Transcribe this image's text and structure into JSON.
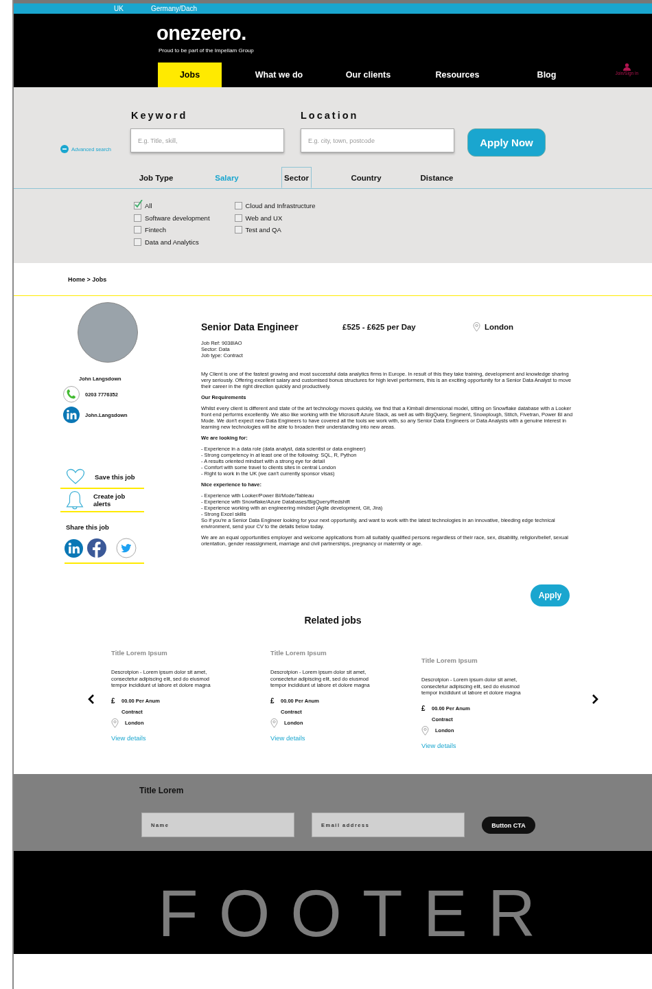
{
  "top_bar": {
    "regions": [
      "UK",
      "Germany/Dach"
    ]
  },
  "header": {
    "logo": "onezeero.",
    "tagline": "Proud to be part of the Impellam Group",
    "account": "Join/Sign in"
  },
  "nav": [
    {
      "label": "Jobs",
      "selected": true
    },
    {
      "label": "What we do",
      "selected": false
    },
    {
      "label": "Our clients",
      "selected": false
    },
    {
      "label": "Resources",
      "selected": false
    },
    {
      "label": "Blog",
      "selected": false
    }
  ],
  "search": {
    "advanced": "Advanced search",
    "keyword_label": "Keyword",
    "keyword_placeholder": "E.g. Title, skill,",
    "location_label": "Location",
    "location_placeholder": "E.g. city, town, postcode",
    "button": "Apply Now"
  },
  "filter_tabs": [
    {
      "label": "Job Type",
      "selected": false,
      "highlighted": false
    },
    {
      "label": "Salary",
      "selected": false,
      "highlighted": true
    },
    {
      "label": "Sector",
      "selected": true,
      "highlighted": false
    },
    {
      "label": "Country",
      "selected": false,
      "highlighted": false
    },
    {
      "label": "Distance",
      "selected": false,
      "highlighted": false
    }
  ],
  "sector_columns": [
    [
      {
        "label": "All",
        "checked": true
      },
      {
        "label": "Software development",
        "checked": false
      },
      {
        "label": "Fintech",
        "checked": false
      },
      {
        "label": "Data and Analytics",
        "checked": false
      }
    ],
    [
      {
        "label": "Cloud and Infrastructure",
        "checked": false
      },
      {
        "label": "Web and UX",
        "checked": false
      },
      {
        "label": "Test and QA",
        "checked": false
      }
    ]
  ],
  "breadcrumb": "Home > Jobs",
  "consultant": {
    "name": "John Langsdown",
    "phone": "0203 7776352",
    "linkedin": "John.Langsdown"
  },
  "actions": [
    "Save this job",
    "Create job alerts"
  ],
  "share": {
    "title": "Share this job"
  },
  "job": {
    "title": "Senior Data Engineer",
    "rate": "£525 - £625 per Day",
    "location": "London",
    "meta": [
      "Job Ref: 9038IAO",
      "Sector: Data",
      "Job type: Contract"
    ],
    "body": [
      {
        "kind": "text",
        "lines": [
          "My Client is one of the fastest growing and most successful data analytics firms in Europe. In result of this they take training, development and knowledge sharing very seriously. Offering excellent salary and customised bonus structures for high level performers, this is an exciting opportunity for a Senior Data Analyst to move their career in the right direction quickly and productively."
        ]
      },
      {
        "kind": "heading",
        "lines": [
          "Our Requirements"
        ]
      },
      {
        "kind": "text",
        "lines": [
          "Whilst every client is different and state of the art technology moves quickly, we find that a Kimball dimensional model, sitting on Snowflake database with a Looker front end performs excellently. We also like working with the Microsoft Azure Stack, as well as with BigQuery, Segment, Snowplough, Stitch, Fivetran, Power BI and Mode. We don't expect new Data Engineers to have covered all the tools we work with, so any Senior Data Engineers or Data Analysts with a genuine interest in learning new technologies will be able to broaden their understanding into new areas."
        ]
      },
      {
        "kind": "heading",
        "lines": [
          "We are looking for:"
        ]
      },
      {
        "kind": "list",
        "lines": [
          "- Experience in a data role (data analyst, data scientist or data engineer)",
          "- Strong competency in at least one of the following: SQL, R, Python",
          "- A results oriented mindset with a strong eye for detail",
          "- Comfort with some travel to clients sites in central London",
          "- Right to work in the UK (we can't currently sponsor visas)"
        ]
      },
      {
        "kind": "heading",
        "lines": [
          "Nice experience to have:"
        ]
      },
      {
        "kind": "tight",
        "lines": [
          "- Experience with Looker/Power BI/Mode/Tableau",
          "- Experience with Snowflake/Azure Databases/BigQuery/Redshift",
          "- Experience working with an engineering mindset (Agile development, Git, Jira)",
          "- Strong Excel skills",
          "So if you're a Senior Data Engineer looking for your next opportunity, and want to work with the latest technologies in an innovative, bleeding edge technical environment, send your CV to the details below today."
        ]
      },
      {
        "kind": "text",
        "lines": [
          "We are an equal opportunities employer and welcome applications from all suitably qualified persons regardless of their race, sex, disability, religion/belief, sexual orientation, gender reassignment, marriage and civil partnerships, pregnancy or maternity or age."
        ]
      }
    ],
    "apply": "Apply"
  },
  "related": {
    "title": "Related jobs",
    "cards": [
      {
        "title": "Title Lorem Ipsum",
        "description": "Descrotpion - Lorem ipsum dolor sit amet, consectetur adipiscing elit, sed do eiusmod tempor incididunt ut labore et dolore magna",
        "currency": "£",
        "salary": "00.00 Per Anum",
        "type": "Contract",
        "location": "London",
        "link": "View details"
      },
      {
        "title": "Title Lorem Ipsum",
        "description": "Descrotpion - Lorem ipsum dolor sit amet, consectetur adipiscing elit, sed do eiusmod tempor incididunt ut labore et dolore magna",
        "currency": "£",
        "salary": "00.00 Per Anum",
        "type": "Contract",
        "location": "London",
        "link": "View details"
      },
      {
        "title": "Title Lorem Ipsum",
        "description": "Descrotpion - Lorem ipsum dolor sit amet, consectetur adipiscing elit, sed do eiusmod tempor incididunt ut labore et dolore magna",
        "currency": "£",
        "salary": "00.00 Per Anum",
        "type": "Contract",
        "location": "London",
        "link": "View details"
      }
    ]
  },
  "newsletter": {
    "title": "Title Lorem",
    "name_placeholder": "Name",
    "email_placeholder": "Email address",
    "button": "Button CTA"
  },
  "footer": {
    "text": "FOOTER"
  }
}
